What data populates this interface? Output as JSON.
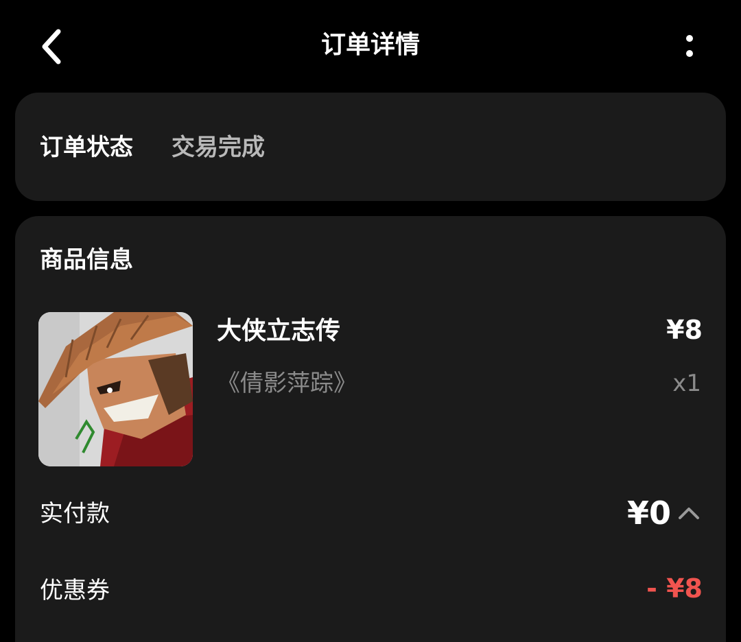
{
  "header": {
    "title": "订单详情",
    "back_icon": "chevron-left-icon",
    "more_icon": "more-vertical-icon"
  },
  "status": {
    "label": "订单状态",
    "value": "交易完成"
  },
  "product": {
    "section_title": "商品信息",
    "name": "大侠立志传",
    "subtitle": "《倩影萍踪》",
    "price": "¥8",
    "quantity": "x1",
    "image": "game-cover-swordsman-icon"
  },
  "payment": {
    "paid_label": "实付款",
    "paid_value": "¥0",
    "expand_icon": "chevron-up-icon",
    "coupon_label": "优惠券",
    "coupon_value": "- ¥8"
  },
  "colors": {
    "background": "#000000",
    "card": "#1b1b1b",
    "muted_text": "#8b8b8b",
    "discount_red": "#f0544f"
  }
}
